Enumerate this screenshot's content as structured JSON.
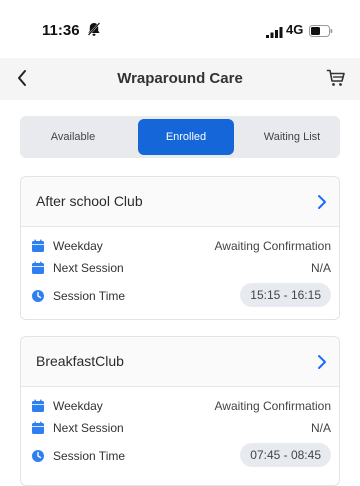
{
  "status": {
    "time": "11:36",
    "network": "4G"
  },
  "nav": {
    "title": "Wraparound Care"
  },
  "tabs": [
    {
      "label": "Available",
      "active": false
    },
    {
      "label": "Enrolled",
      "active": true
    },
    {
      "label": "Waiting List",
      "active": false
    }
  ],
  "cards": [
    {
      "title": "After school Club",
      "weekday_label": "Weekday",
      "weekday_value": "Awaiting Confirmation",
      "next_label": "Next Session",
      "next_value": "N/A",
      "time_label": "Session Time",
      "time_value": "15:15 - 16:15"
    },
    {
      "title": "BreakfastClub",
      "weekday_label": "Weekday",
      "weekday_value": "Awaiting Confirmation",
      "next_label": "Next Session",
      "next_value": "N/A",
      "time_label": "Session Time",
      "time_value": "07:45 - 08:45"
    }
  ],
  "colors": {
    "accent": "#1466d9",
    "calendar_icon": "#2f7ff0",
    "chevron": "#1a6cff"
  },
  "icons": {
    "status": [
      "mute-bell-icon",
      "signal-icon",
      "battery-icon"
    ],
    "nav": [
      "back-chevron-icon",
      "cart-icon"
    ],
    "rows": [
      "calendar-icon",
      "clock-icon"
    ]
  }
}
